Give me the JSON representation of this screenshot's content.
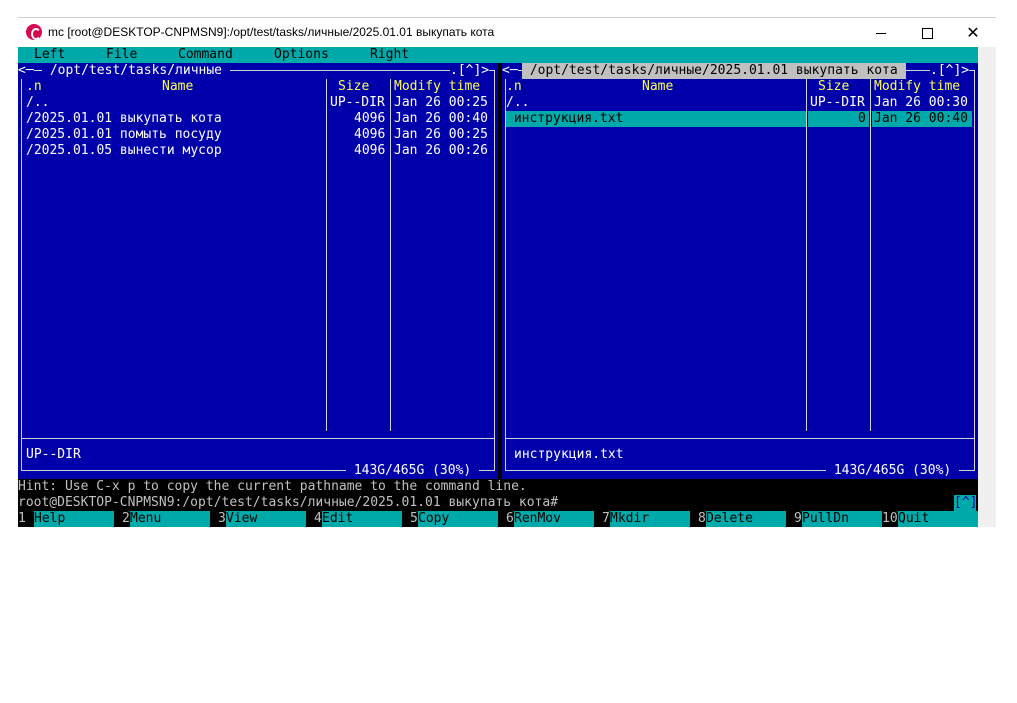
{
  "window": {
    "title": "mc [root@DESKTOP-CNPMSN9]:/opt/test/tasks/личные/2025.01.01 выкупать кота",
    "close_glyph": "✕"
  },
  "menubar": [
    "Left",
    "File",
    "Command",
    "Options",
    "Right"
  ],
  "left_panel": {
    "title": " /opt/test/tasks/личные ",
    "corner_left": "<─",
    "corner_right": ".[^]>",
    "headers": {
      "n": ".n",
      "name": "Name",
      "size": "Size",
      "mtime": "Modify time"
    },
    "rows": [
      {
        "name": "/..",
        "size": "UP--DIR",
        "mtime": "Jan 26 00:25"
      },
      {
        "name": "/2025.01.01 выкупать кота",
        "size": "4096",
        "mtime": "Jan 26 00:40"
      },
      {
        "name": "/2025.01.01 помыть посуду",
        "size": "4096",
        "mtime": "Jan 26 00:25"
      },
      {
        "name": "/2025.01.05 вынести мусор",
        "size": "4096",
        "mtime": "Jan 26 00:26"
      }
    ],
    "status": "UP--DIR",
    "disk": " 143G/465G (30%) "
  },
  "right_panel": {
    "title": " /opt/test/tasks/личные/2025.01.01 выкупать кота ",
    "corner_left": "<─",
    "corner_right": ".[^]>",
    "headers": {
      "n": ".n",
      "name": "Name",
      "size": "Size",
      "mtime": "Modify time"
    },
    "rows": [
      {
        "name": "/..",
        "size": "UP--DIR",
        "mtime": "Jan 26 00:30"
      },
      {
        "name": " инструкция.txt",
        "size": "0",
        "mtime": "Jan 26 00:40",
        "selected": true
      }
    ],
    "status": "инструкция.txt",
    "disk": " 143G/465G (30%) "
  },
  "hint": "Hint: Use C-x p to copy the current pathname to the command line.",
  "command_line": "root@DESKTOP-CNPMSN9:/opt/test/tasks/личные/2025.01.01 выкупать кота#",
  "cmd_scroll": "[^]",
  "fkeys": [
    {
      "num": "1",
      "label": "Help"
    },
    {
      "num": "2",
      "label": "Menu"
    },
    {
      "num": "3",
      "label": "View"
    },
    {
      "num": "4",
      "label": "Edit"
    },
    {
      "num": "5",
      "label": "Copy"
    },
    {
      "num": "6",
      "label": "RenMov"
    },
    {
      "num": "7",
      "label": "Mkdir"
    },
    {
      "num": "8",
      "label": "Delete"
    },
    {
      "num": "9",
      "label": "PullDn"
    },
    {
      "num": "10",
      "label": "Quit"
    }
  ],
  "colors": {
    "panel_bg": "#0000aa",
    "accent": "#00aaaa",
    "header_text": "#ffff55"
  }
}
